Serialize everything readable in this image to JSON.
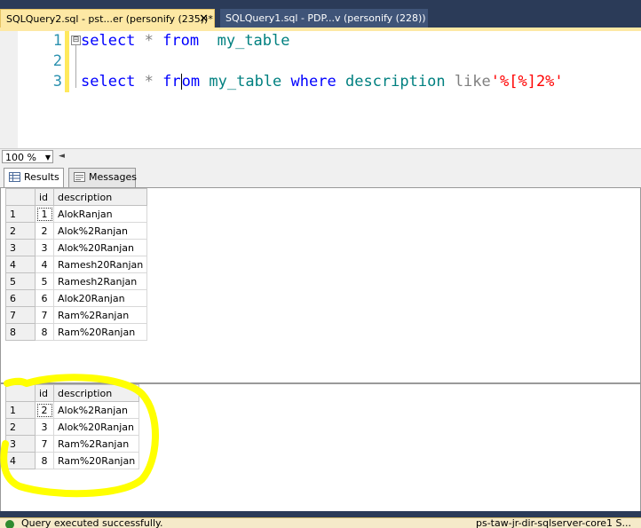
{
  "document_tabs": [
    {
      "label": "SQLQuery2.sql - pst...er (personify (235))*",
      "close": "✕"
    },
    {
      "label": "SQLQuery1.sql - PDP...v (personify (228))"
    }
  ],
  "editor": {
    "line_numbers": [
      "1",
      "2",
      "3"
    ],
    "outline_toggle": "⊟",
    "line1": {
      "kw1": "select",
      "star": "*",
      "kw2": "from",
      "table": "my_table"
    },
    "line3": {
      "kw1": "select",
      "star": "*",
      "kw2a": "fr",
      "kw2b": "om",
      "table": "my_table",
      "kw3": "where",
      "col": "description",
      "op": "like",
      "str": "'%[%]2%'"
    }
  },
  "zoom": {
    "value": "100 %"
  },
  "result_tabs": {
    "results_label": "Results",
    "messages_label": "Messages"
  },
  "grid1": {
    "headers": [
      "id",
      "description"
    ],
    "rows": [
      [
        "1",
        "1",
        "AlokRanjan"
      ],
      [
        "2",
        "2",
        "Alok%2Ranjan"
      ],
      [
        "3",
        "3",
        "Alok%20Ranjan"
      ],
      [
        "4",
        "4",
        "Ramesh20Ranjan"
      ],
      [
        "5",
        "5",
        "Ramesh2Ranjan"
      ],
      [
        "6",
        "6",
        "Alok20Ranjan"
      ],
      [
        "7",
        "7",
        "Ram%2Ranjan"
      ],
      [
        "8",
        "8",
        "Ram%20Ranjan"
      ]
    ]
  },
  "grid2": {
    "headers": [
      "id",
      "description"
    ],
    "rows": [
      [
        "1",
        "2",
        "Alok%2Ranjan"
      ],
      [
        "2",
        "3",
        "Alok%20Ranjan"
      ],
      [
        "3",
        "7",
        "Ram%2Ranjan"
      ],
      [
        "4",
        "8",
        "Ram%20Ranjan"
      ]
    ]
  },
  "status": {
    "message": "Query executed successfully.",
    "server": "ps-taw-jr-dir-sqlserver-core1 S..."
  },
  "colors": {
    "highlight": "#ffff00",
    "accent": "#fde8a4"
  }
}
